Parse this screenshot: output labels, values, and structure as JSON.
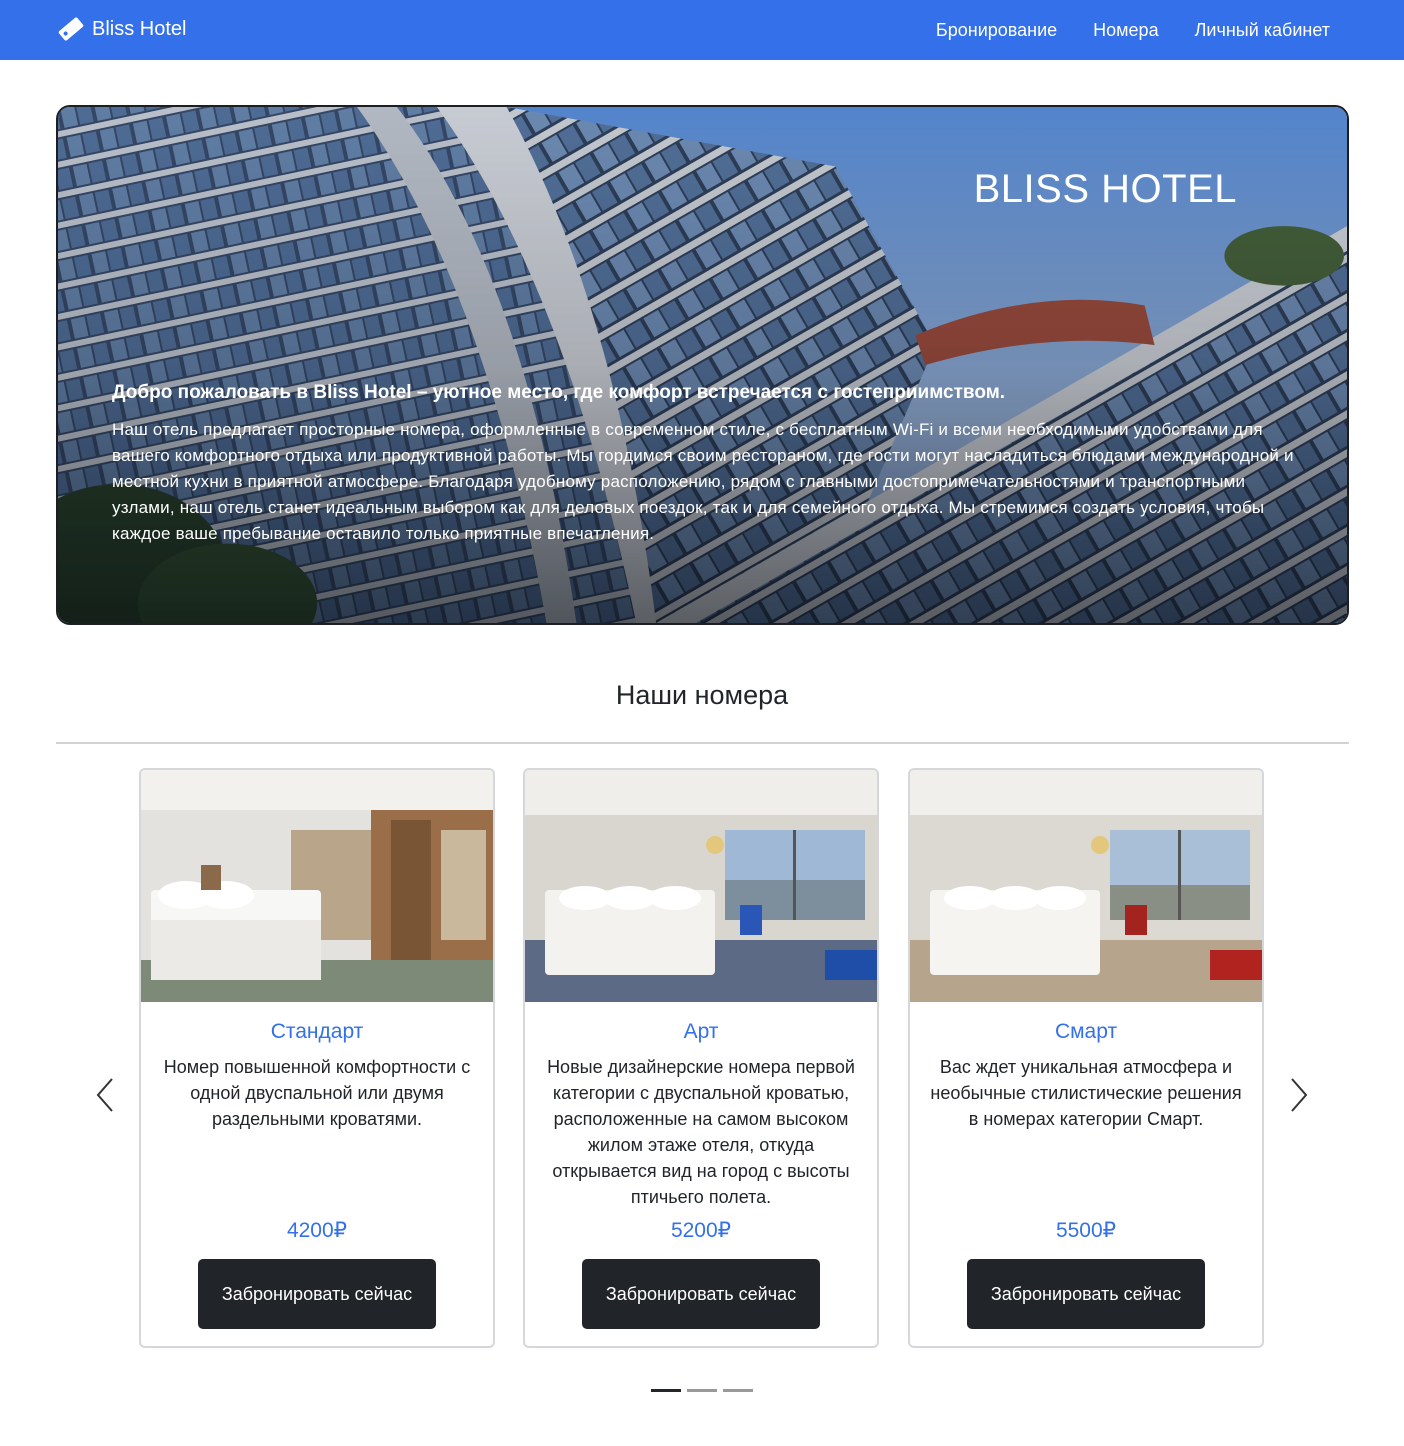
{
  "navbar": {
    "brand": "Bliss Hotel",
    "brand_icon": "ticket-icon",
    "links": [
      "Бронирование",
      "Номера",
      "Личный кабинет"
    ],
    "color": "#3370ea"
  },
  "hero": {
    "title": "BLISS HOTEL",
    "lead": "Добро пожаловать в Bliss Hotel – уютное место, где комфорт встречается с гостеприимством.",
    "text": "Наш отель предлагает просторные номера, оформленные в современном стиле, с бесплатным Wi-Fi и всеми необходимыми удобствами для вашего комфортного отдыха или продуктивной работы. Мы гордимся своим рестораном, где гости могут насладиться блюдами международной и местной кухни в приятной атмосфере. Благодаря удобному расположению, рядом с главными достопримечательностями и транспортными узлами, наш отель станет идеальным выбором как для деловых поездок, так и для семейного отдыха. Мы стремимся создать условия, чтобы каждое ваше пребывание оставило только приятные впечатления."
  },
  "rooms": {
    "title": "Наши номера",
    "cards": [
      {
        "title": "Стандарт",
        "description": "Номер повышенной комфортности с одной двуспальной или двумя раздельными кроватями.",
        "price": "4200₽",
        "button": "Забронировать сейчас"
      },
      {
        "title": "Арт",
        "description": "Новые дизайнерские номера первой категории с двуспальной кроватью, расположенные на самом высоком жилом этаже отеля, откуда открывается вид на город с высоты птичьего полета.",
        "price": "5200₽",
        "button": "Забронировать сейчас"
      },
      {
        "title": "Смарт",
        "description": "Вас ждет уникальная атмосфера и необычные стилистические решения в номерах категории Смарт.",
        "price": "5500₽",
        "button": "Забронировать сейчас"
      }
    ],
    "carousel": {
      "prev_icon": "chevron-left-icon",
      "next_icon": "chevron-right-icon",
      "slides": 3,
      "active_slide": 1
    }
  }
}
